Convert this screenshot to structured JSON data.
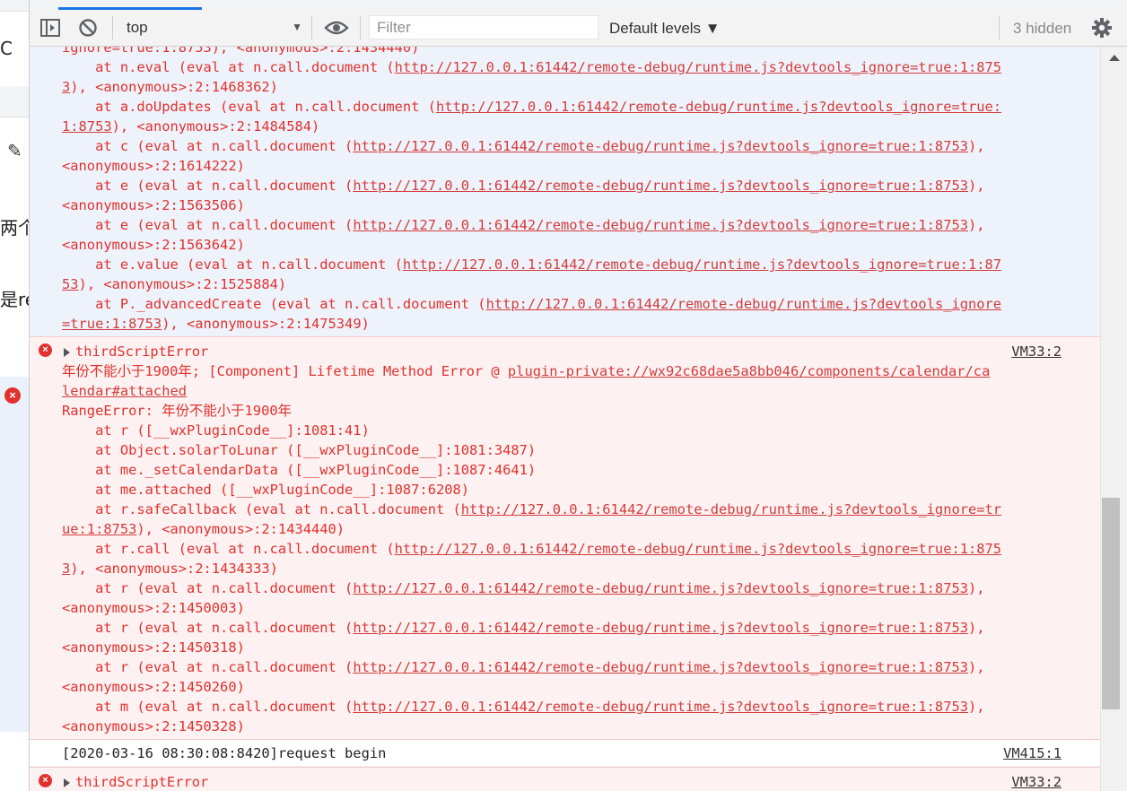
{
  "left_strip": {
    "items": [
      "C",
      "两个",
      "是re"
    ]
  },
  "toolbar": {
    "context": "top",
    "filter_placeholder": "Filter",
    "levels": "Default levels ▼",
    "hidden": "3 hidden"
  },
  "console": {
    "block1": {
      "lines": [
        {
          "t": "ignore=true:1:8753), <anonymous>:2:1434440)"
        },
        {
          "pre": "    at n.eval (eval at n.call.document (",
          "url": "http://127.0.0.1:61442/remote-debug/runtime.js?devtools_ignore=true:1:875"
        },
        {
          "url": "3",
          "post": "), <anonymous>:2:1468362)"
        },
        {
          "pre": "    at a.doUpdates (eval at n.call.document (",
          "url": "http://127.0.0.1:61442/remote-debug/runtime.js?devtools_ignore=true:"
        },
        {
          "url": "1:8753",
          "post": "), <anonymous>:2:1484584)"
        },
        {
          "pre": "    at c (eval at n.call.document (",
          "url": "http://127.0.0.1:61442/remote-debug/runtime.js?devtools_ignore=true:1:8753",
          "post": "),"
        },
        {
          "t": "<anonymous>:2:1614222)"
        },
        {
          "pre": "    at e (eval at n.call.document (",
          "url": "http://127.0.0.1:61442/remote-debug/runtime.js?devtools_ignore=true:1:8753",
          "post": "),"
        },
        {
          "t": "<anonymous>:2:1563506)"
        },
        {
          "pre": "    at e (eval at n.call.document (",
          "url": "http://127.0.0.1:61442/remote-debug/runtime.js?devtools_ignore=true:1:8753",
          "post": "),"
        },
        {
          "t": "<anonymous>:2:1563642)"
        },
        {
          "pre": "    at e.value (eval at n.call.document (",
          "url": "http://127.0.0.1:61442/remote-debug/runtime.js?devtools_ignore=true:1:87"
        },
        {
          "url": "53",
          "post": "), <anonymous>:2:1525884)"
        },
        {
          "pre": "    at P._advancedCreate (eval at n.call.document (",
          "url": "http://127.0.0.1:61442/remote-debug/runtime.js?devtools_ignore"
        },
        {
          "url": "=true:1:8753",
          "post": "), <anonymous>:2:1475349)"
        }
      ]
    },
    "block2": {
      "summary": "thirdScriptError",
      "source": "VM33:2",
      "lines": [
        {
          "pre": "年份不能小于1900年; [Component] Lifetime Method Error @ ",
          "url": "plugin-private://wx92c68dae5a8bb046/components/calendar/ca"
        },
        {
          "url": "lendar#attached"
        },
        {
          "t": "RangeError: 年份不能小于1900年"
        },
        {
          "t": "    at r ([__wxPluginCode__]:1081:41)"
        },
        {
          "t": "    at Object.solarToLunar ([__wxPluginCode__]:1081:3487)"
        },
        {
          "t": "    at me._setCalendarData ([__wxPluginCode__]:1087:4641)"
        },
        {
          "t": "    at me.attached ([__wxPluginCode__]:1087:6208)"
        },
        {
          "pre": "    at r.safeCallback (eval at n.call.document (",
          "url": "http://127.0.0.1:61442/remote-debug/runtime.js?devtools_ignore=tr"
        },
        {
          "url": "ue:1:8753",
          "post": "), <anonymous>:2:1434440)"
        },
        {
          "pre": "    at r.call (eval at n.call.document (",
          "url": "http://127.0.0.1:61442/remote-debug/runtime.js?devtools_ignore=true:1:875"
        },
        {
          "url": "3",
          "post": "), <anonymous>:2:1434333)"
        },
        {
          "pre": "    at r (eval at n.call.document (",
          "url": "http://127.0.0.1:61442/remote-debug/runtime.js?devtools_ignore=true:1:8753",
          "post": "),"
        },
        {
          "t": "<anonymous>:2:1450003)"
        },
        {
          "pre": "    at r (eval at n.call.document (",
          "url": "http://127.0.0.1:61442/remote-debug/runtime.js?devtools_ignore=true:1:8753",
          "post": "),"
        },
        {
          "t": "<anonymous>:2:1450318)"
        },
        {
          "pre": "    at r (eval at n.call.document (",
          "url": "http://127.0.0.1:61442/remote-debug/runtime.js?devtools_ignore=true:1:8753",
          "post": "),"
        },
        {
          "t": "<anonymous>:2:1450260)"
        },
        {
          "pre": "    at m (eval at n.call.document (",
          "url": "http://127.0.0.1:61442/remote-debug/runtime.js?devtools_ignore=true:1:8753",
          "post": "),"
        },
        {
          "t": "<anonymous>:2:1450328)"
        }
      ]
    },
    "block3": {
      "text": "[2020-03-16 08:30:08:8420]request begin",
      "source": "VM415:1"
    },
    "block4": {
      "summary": "thirdScriptError",
      "source": "VM33:2"
    }
  }
}
